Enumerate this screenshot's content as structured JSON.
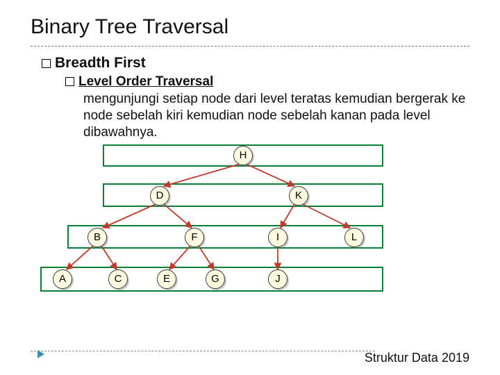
{
  "title": "Binary Tree Traversal",
  "section": {
    "heading": "Breadth First",
    "subheading": "Level Order Traversal"
  },
  "description": "mengunjungi setiap node dari level teratas kemudian bergerak ke node sebelah kiri  kemudian node sebelah kanan pada level dibawahnya.",
  "tree": {
    "root": "H",
    "levels": [
      [
        "H"
      ],
      [
        "D",
        "K"
      ],
      [
        "B",
        "F",
        "I",
        "L"
      ],
      [
        "A",
        "C",
        "E",
        "G",
        "J"
      ]
    ],
    "edges": [
      [
        "H",
        "D"
      ],
      [
        "H",
        "K"
      ],
      [
        "D",
        "B"
      ],
      [
        "D",
        "F"
      ],
      [
        "K",
        "I"
      ],
      [
        "K",
        "L"
      ],
      [
        "B",
        "A"
      ],
      [
        "B",
        "C"
      ],
      [
        "F",
        "E"
      ],
      [
        "F",
        "G"
      ],
      [
        "I",
        "J"
      ]
    ]
  },
  "footer": "Struktur Data 2019"
}
